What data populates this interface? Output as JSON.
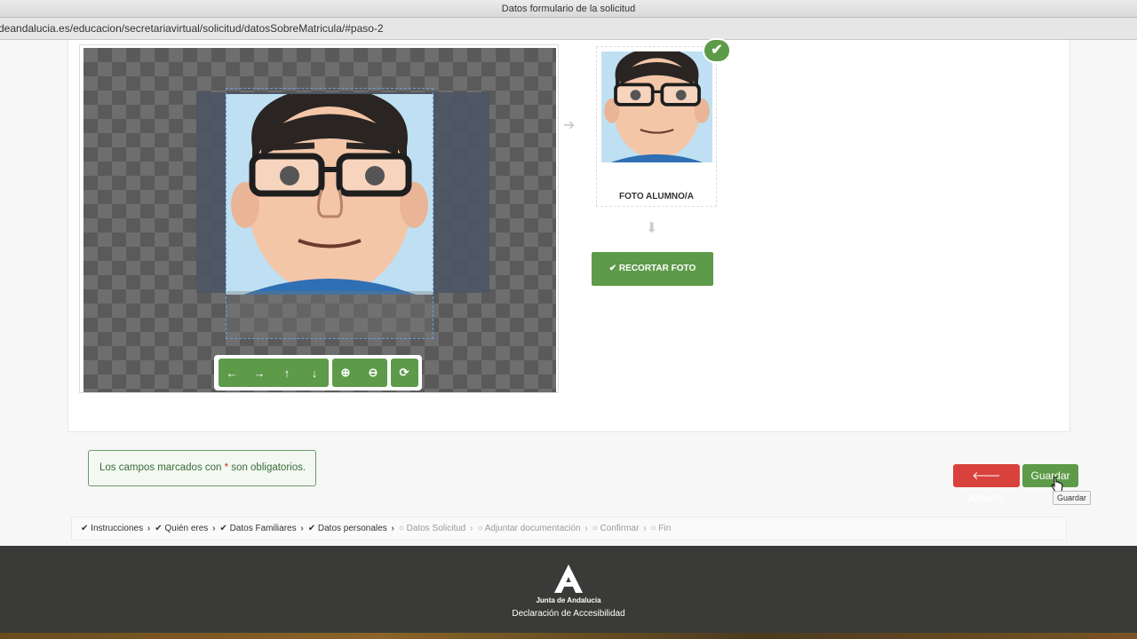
{
  "window": {
    "title": "Datos formulario de la solicitud"
  },
  "browser": {
    "url": "deandalucia.es/educacion/secretariavirtual/solicitud/datosSobreMatricula/#paso-2"
  },
  "cropper": {
    "toolbar": [
      {
        "name": "move-left-button",
        "icon": "arrow-left-icon",
        "glyph": "←"
      },
      {
        "name": "move-right-button",
        "icon": "arrow-right-icon",
        "glyph": "→"
      },
      {
        "name": "move-up-button",
        "icon": "arrow-up-icon",
        "glyph": "↑"
      },
      {
        "name": "move-down-button",
        "icon": "arrow-down-icon",
        "glyph": "↓"
      },
      {
        "name": "zoom-in-button",
        "icon": "zoom-in-icon",
        "glyph": "⊕"
      },
      {
        "name": "zoom-out-button",
        "icon": "zoom-out-icon",
        "glyph": "⊖"
      },
      {
        "name": "reset-button",
        "icon": "refresh-icon",
        "glyph": "⟳"
      }
    ]
  },
  "preview": {
    "label": "FOTO ALUMNO/A",
    "check_glyph": "✔",
    "arrow_right": "➔",
    "arrow_down": "⬇"
  },
  "crop_button": {
    "label": "✔ RECORTAR FOTO"
  },
  "notice": {
    "prefix": "Los campos marcados con ",
    "star": "*",
    "suffix": " son obligatorios."
  },
  "actions": {
    "previous": "🡐 Anterior",
    "save": "Guardar",
    "tooltip": "Guardar"
  },
  "steps": [
    {
      "label": "Instrucciones",
      "done": true
    },
    {
      "label": "Quién eres",
      "done": true
    },
    {
      "label": "Datos Familiares",
      "done": true
    },
    {
      "label": "Datos personales",
      "done": true
    },
    {
      "label": "Datos Solicitud",
      "done": false
    },
    {
      "label": "Adjuntar documentación",
      "done": false
    },
    {
      "label": "Confirmar",
      "done": false
    },
    {
      "label": "Fin",
      "done": false
    }
  ],
  "footer": {
    "org": "Junta de Andalucía",
    "link": "Declaración de Accesibilidad"
  },
  "colors": {
    "green": "#5d9a49",
    "red": "#d9423c",
    "footer": "#3a3a38"
  }
}
